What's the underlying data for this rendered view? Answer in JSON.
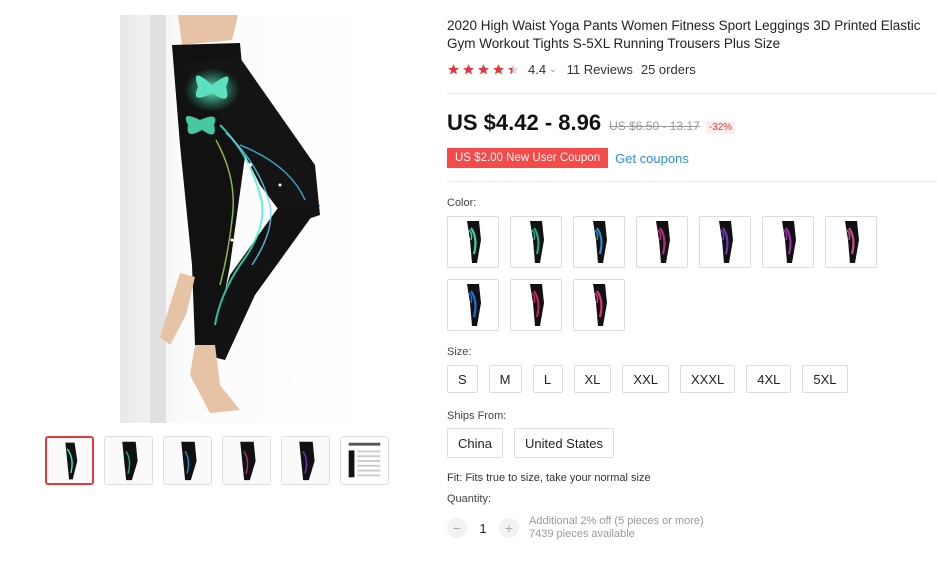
{
  "product": {
    "title": "2020 High Waist Yoga Pants Women Fitness Sport Leggings 3D Printed Elastic Gym Workout Tights S-5XL Running Trousers Plus Size",
    "rating_value": "4.4",
    "reviews": "11 Reviews",
    "orders": "25 orders",
    "stars": 4.4
  },
  "pricing": {
    "price": "US $4.42 - 8.96",
    "original_price": "US $6.50 - 13.17",
    "discount": "-32%",
    "coupon_label": "US $2.00 New User Coupon",
    "get_coupons": "Get coupons"
  },
  "color": {
    "label": "Color:",
    "swatches": [
      {
        "name": "black-green",
        "accent": "#3fd0b0"
      },
      {
        "name": "teal",
        "accent": "#22a88a"
      },
      {
        "name": "blue-teal",
        "accent": "#2a8bc6"
      },
      {
        "name": "pink-purple",
        "accent": "#b0307e"
      },
      {
        "name": "purple-blue",
        "accent": "#6a38b8"
      },
      {
        "name": "magenta",
        "accent": "#9a2fa6"
      },
      {
        "name": "pink-flower",
        "accent": "#c84a8a"
      },
      {
        "name": "blue",
        "accent": "#1e6fd8"
      },
      {
        "name": "red-pink",
        "accent": "#b82c5a"
      },
      {
        "name": "hot-pink",
        "accent": "#e0307e"
      }
    ]
  },
  "size": {
    "label": "Size:",
    "options": [
      "S",
      "M",
      "L",
      "XL",
      "XXL",
      "XXXL",
      "4XL",
      "5XL"
    ]
  },
  "ships_from": {
    "label": "Ships From:",
    "options": [
      "China",
      "United States"
    ]
  },
  "fit": "Fit: Fits true to size, take your normal size",
  "quantity": {
    "label": "Quantity:",
    "value": "1",
    "minus": "−",
    "plus": "+",
    "discount_note": "Additional 2% off (5 pieces or more)",
    "available": "7439 pieces available"
  },
  "colors": {
    "accent": "#e4393c",
    "coupon_bg": "#f44a4a",
    "link": "#2e8fd6"
  }
}
